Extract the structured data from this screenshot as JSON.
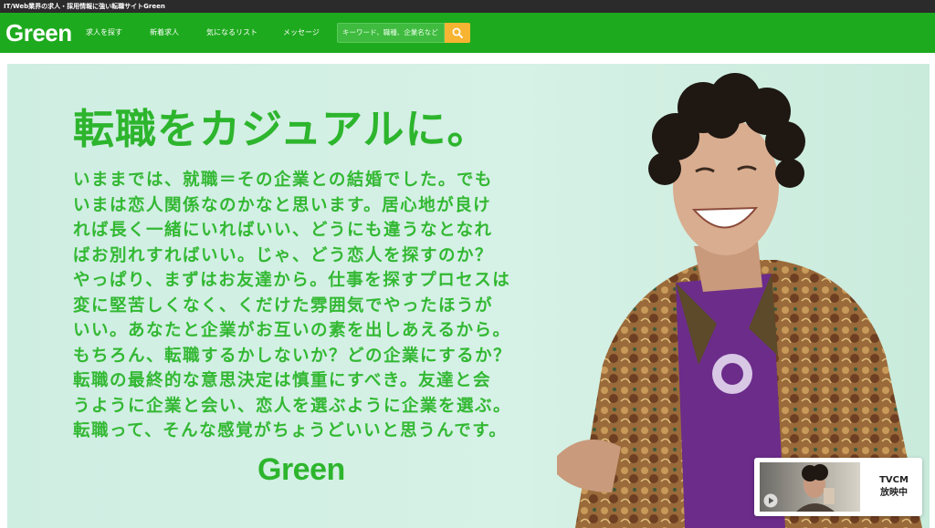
{
  "topbar": {
    "text": "IT/Web業界の求人・採用情報に強い転職サイトGreen"
  },
  "nav": {
    "logo": "Green",
    "items": [
      "求人を探す",
      "新着求人",
      "気になるリスト",
      "メッセージ"
    ],
    "search_placeholder": "キーワード、職種、企業名など",
    "search_icon": "search-icon"
  },
  "hero": {
    "headline": "転職をカジュアルに。",
    "body_lines": [
      "いままでは、就職＝その企業との結婚でした。でも",
      "いまは恋人関係なのかなと思います。居心地が良け",
      "れば長く一緒にいればいい、どうにも違うなとなれ",
      "ばお別れすればいい。じゃ、どう恋人を探すのか？",
      "やっぱり、まずはお友達から。仕事を探すプロセスは",
      "変に堅苦しくなく、くだけた雰囲気でやったほうが",
      "いい。あなたと企業がお互いの素を出しあえるから。",
      "もちろん、転職するかしないか？どの企業にするか？",
      "転職の最終的な意思決定は慎重にすべき。友達と会",
      "うように企業と会い、恋人を選ぶように企業を選ぶ。",
      "転職って、そんな感覚がちょうどいいと思うんです。"
    ],
    "logo": "Green"
  },
  "tvcm": {
    "line1": "TVCM",
    "line2": "放映中",
    "play_icon": "play-icon"
  },
  "colors": {
    "brand_green": "#1eaa1e",
    "text_green": "#33b833",
    "search_button": "#f7b432"
  }
}
